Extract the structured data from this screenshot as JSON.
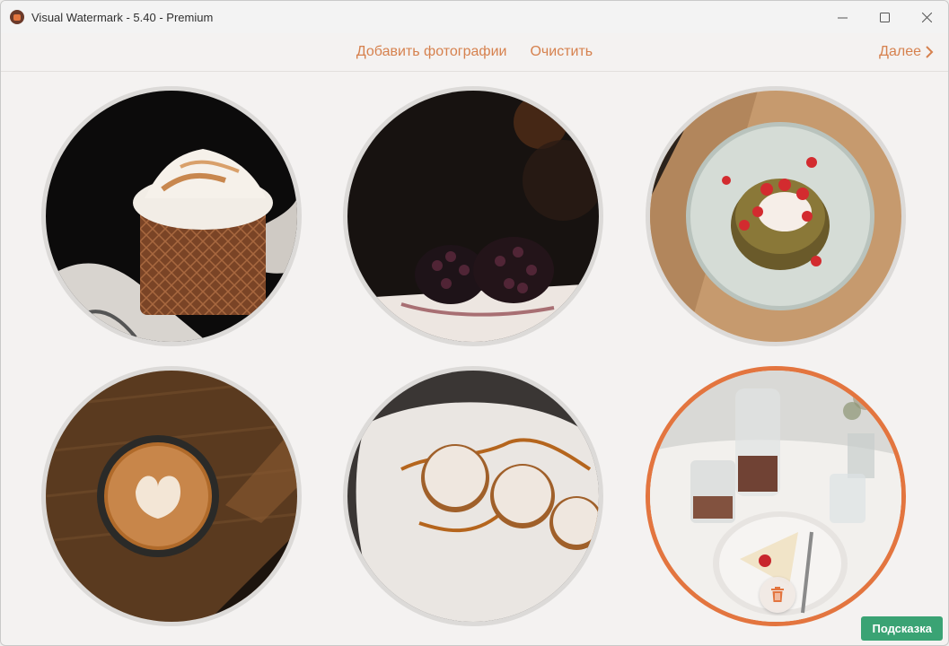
{
  "window": {
    "title": "Visual Watermark - 5.40 - Premium"
  },
  "toolbar": {
    "add_photos": "Добавить фотографии",
    "clear": "Очистить",
    "next": "Далее"
  },
  "photos": [
    {
      "subject": "cupcake-meringue",
      "selected": false
    },
    {
      "subject": "blackberries-cake",
      "selected": false
    },
    {
      "subject": "pancakes-strawberries",
      "selected": false
    },
    {
      "subject": "latte-art-coffee",
      "selected": false
    },
    {
      "subject": "sugared-pastries-plate",
      "selected": false
    },
    {
      "subject": "table-cake-carafe",
      "selected": true
    }
  ],
  "hint_button": "Подсказка",
  "colors": {
    "accent": "#e3753f",
    "link": "#d6814e",
    "hint": "#3aa374"
  }
}
